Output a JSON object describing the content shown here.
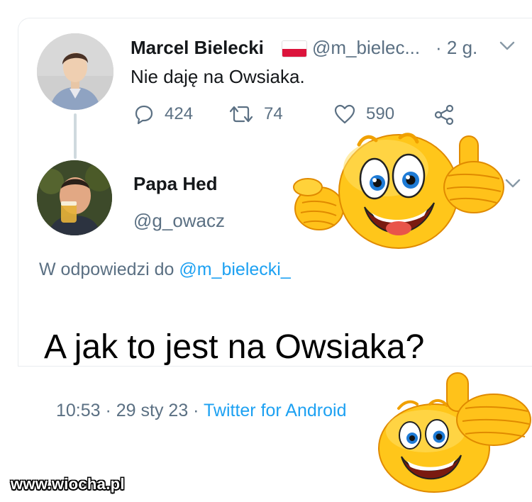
{
  "tweet": {
    "author_name": "Marcel Bielecki",
    "author_handle": "@m_bielec...",
    "time_ago": "· 2 g.",
    "text": "Nie daję na Owsiaka.",
    "actions": {
      "replies": "424",
      "retweets": "74",
      "likes": "590"
    }
  },
  "reply": {
    "author_name": "Papa Hed",
    "author_handle": "@g_owacz",
    "reply_prefix": "W odpowiedzi do",
    "reply_mention": "@m_bielecki_",
    "caption": "A jak to jest na Owsiaka?",
    "timestamp": "10:53 · 29 sty 23 · ",
    "source": "Twitter for Android"
  },
  "watermark": "www.wiocha.pl",
  "icons": {
    "reply": "reply-icon",
    "retweet": "retweet-icon",
    "like": "heart-icon",
    "share": "share-icon",
    "more": "chevron-down-icon",
    "flag": "poland-flag-icon",
    "emoji": "thumbs-up-smiley-icon"
  },
  "colors": {
    "text": "#14171a",
    "muted": "#5b7083",
    "link": "#1da1f2",
    "flag_red": "#dc143c",
    "emoji_yellow": "#ffcc1a"
  }
}
